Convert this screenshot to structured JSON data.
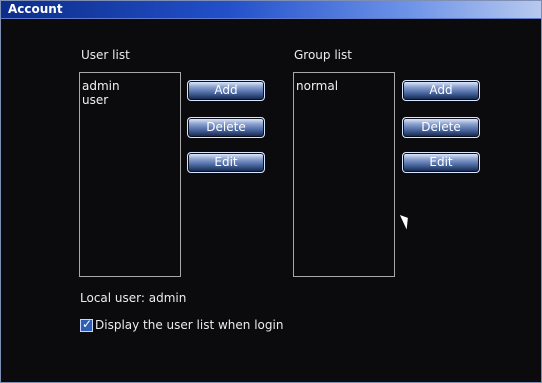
{
  "window": {
    "title": "Account"
  },
  "user_panel": {
    "label": "User list",
    "items": [
      "admin",
      "user"
    ],
    "buttons": {
      "add": "Add",
      "delete": "Delete",
      "edit": "Edit"
    }
  },
  "group_panel": {
    "label": "Group list",
    "items": [
      "normal"
    ],
    "buttons": {
      "add": "Add",
      "delete": "Delete",
      "edit": "Edit"
    }
  },
  "footer": {
    "local_user_text": "Local user:  admin",
    "display_user_list_checkbox": {
      "checked": true,
      "label": "Display  the  user  list  when  login"
    }
  },
  "icons": {
    "pointer": "mouse-pointer-icon",
    "checkbox": "checkbox-icon"
  },
  "colors": {
    "background": "#0b0b0d",
    "title_bar_start": "#0c2d8a",
    "title_bar_end": "#b7c9ee",
    "button_text": "#ffffff",
    "checkbox": "#2f5fb5"
  }
}
